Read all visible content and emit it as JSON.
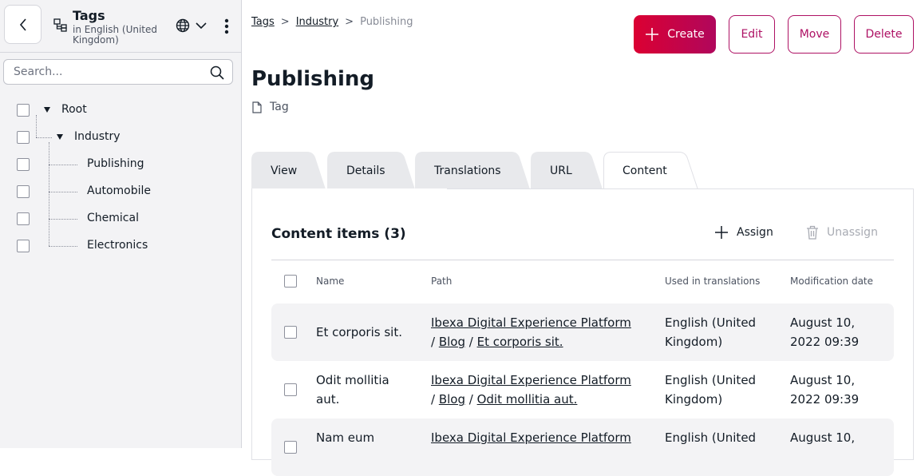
{
  "sidebar": {
    "title": "Tags",
    "subtitle": "in English (United Kingdom)",
    "search_placeholder": "Search...",
    "tree": [
      {
        "label": "Root"
      },
      {
        "label": "Industry"
      },
      {
        "label": "Publishing"
      },
      {
        "label": "Automobile"
      },
      {
        "label": "Chemical"
      },
      {
        "label": "Electronics"
      }
    ]
  },
  "breadcrumb": {
    "items": [
      "Tags",
      "Industry",
      "Publishing"
    ],
    "separator": ">"
  },
  "actions": {
    "create": "Create",
    "edit": "Edit",
    "move": "Move",
    "delete": "Delete"
  },
  "page": {
    "title": "Publishing",
    "type": "Tag"
  },
  "tabs": [
    {
      "label": "View"
    },
    {
      "label": "Details"
    },
    {
      "label": "Translations"
    },
    {
      "label": "URL"
    },
    {
      "label": "Content",
      "active": true
    }
  ],
  "content": {
    "heading": "Content items (3)",
    "assign": "Assign",
    "unassign": "Unassign",
    "columns": [
      "Name",
      "Path",
      "Used in translations",
      "Modification date"
    ],
    "rows": [
      {
        "name": "Et corporis sit.",
        "path": [
          "Ibexa Digital Experience Platform",
          "Blog",
          "Et corporis sit."
        ],
        "translations_line1": "English (United",
        "translations_line2": "Kingdom)",
        "date_line1": "August 10,",
        "date_line2": "2022 09:39"
      },
      {
        "name_line1": "Odit mollitia",
        "name_line2": "aut.",
        "path": [
          "Ibexa Digital Experience Platform",
          "Blog",
          "Odit mollitia aut."
        ],
        "translations_line1": "English (United",
        "translations_line2": "Kingdom)",
        "date_line1": "August 10,",
        "date_line2": "2022 09:39"
      },
      {
        "name_line1": "Nam eum",
        "path": [
          "Ibexa Digital Experience Platform"
        ],
        "translations_line1": "English (United",
        "date_line1": "August 10,"
      }
    ]
  },
  "colors": {
    "brand": "#ae1164",
    "brand_gradient_start": "#db0032",
    "sidebar_bg": "#f3f3f5",
    "row_shade": "#f3f3f5"
  }
}
